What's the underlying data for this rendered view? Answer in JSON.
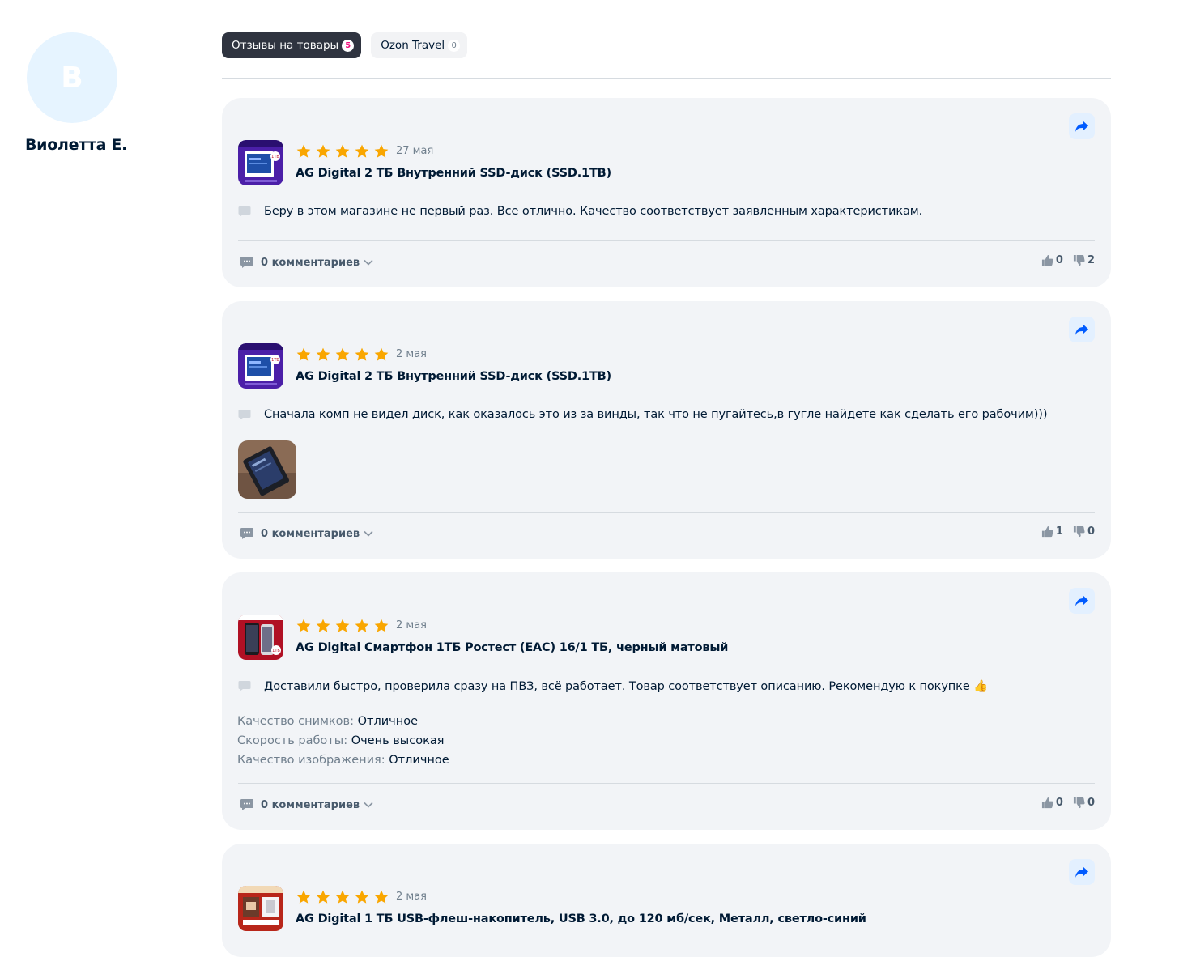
{
  "profile": {
    "avatar_letter": "В",
    "name": "Виолетта Е."
  },
  "tabs": [
    {
      "label": "Отзывы на товары",
      "count": "5",
      "active": true
    },
    {
      "label": "Ozon Travel",
      "count": "0",
      "active": false
    }
  ],
  "colors": {
    "star": "#f9a600",
    "accent": "#005bff",
    "active_tab": "#2f3440",
    "badge": "#f1117e"
  },
  "reviews": [
    {
      "rating": 5,
      "date": "27 мая",
      "product": "AG Digital 2 ТБ Внутренний SSD-диск (SSD.1TB)",
      "text": "Беру в этом магазине не первый раз. Все отлично. Качество соответствует заявленным характеристикам.",
      "comments": "0 комментариев",
      "likes": "0",
      "dislikes": "2"
    },
    {
      "rating": 5,
      "date": "2 мая",
      "product": "AG Digital 2 ТБ Внутренний SSD-диск (SSD.1TB)",
      "text": "Сначала комп не видел диск, как оказалось это из за винды, так что не пугайтесь,в гугле найдете как сделать его рабочим)))",
      "comments": "0 комментариев",
      "likes": "1",
      "dislikes": "0"
    },
    {
      "rating": 5,
      "date": "2 мая",
      "product": "AG Digital Смартфон 1ТБ Ростест (EAC) 16/1 ТБ, черный матовый",
      "text": "Доставили быстро, проверила сразу на ПВЗ, всё работает. Товар соответствует описанию. Рекомендую к покупке 👍",
      "attributes": [
        {
          "key": "Качество снимков:",
          "value": "Отличное"
        },
        {
          "key": "Скорость работы:",
          "value": "Очень высокая"
        },
        {
          "key": "Качество изображения:",
          "value": "Отличное"
        }
      ],
      "comments": "0 комментариев",
      "likes": "0",
      "dislikes": "0"
    },
    {
      "rating": 5,
      "date": "2 мая",
      "product": "AG Digital 1 ТБ USB-флеш-накопитель, USB 3.0, до 120 мб/сек, Металл, светло-синий"
    }
  ],
  "thumb_labels": {
    "ssd": "1TB",
    "phone": "1TБ"
  },
  "icons": [
    "share-icon",
    "star-icon",
    "comment-icon",
    "chevron-down-icon",
    "thumbs-up-icon",
    "thumbs-down-icon"
  ]
}
